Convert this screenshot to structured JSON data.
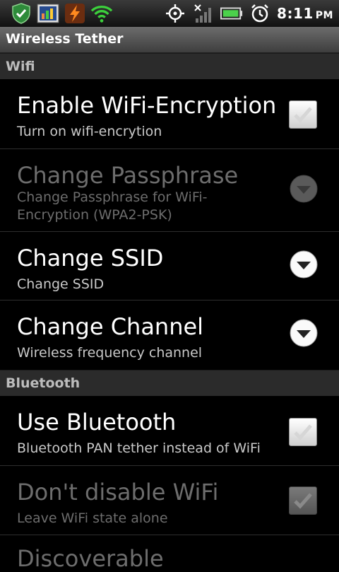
{
  "status_bar": {
    "time": "8:11",
    "ampm": "PM"
  },
  "app": {
    "title": "Wireless Tether"
  },
  "sections": {
    "wifi": "Wifi",
    "bluetooth": "Bluetooth"
  },
  "prefs": {
    "enable_encryption": {
      "title": "Enable WiFi-Encryption",
      "summary": "Turn on wifi-encrytion"
    },
    "change_passphrase": {
      "title": "Change Passphrase",
      "summary": "Change Passphrase for WiFi-Encryption (WPA2-PSK)"
    },
    "change_ssid": {
      "title": "Change SSID",
      "summary": "Change SSID"
    },
    "change_channel": {
      "title": "Change Channel",
      "summary": "Wireless frequency channel"
    },
    "use_bluetooth": {
      "title": "Use Bluetooth",
      "summary": "Bluetooth PAN tether instead of WiFi"
    },
    "dont_disable_wifi": {
      "title": "Don't disable WiFi",
      "summary": "Leave WiFi state alone"
    },
    "discoverable": {
      "title": "Discoverable"
    }
  }
}
